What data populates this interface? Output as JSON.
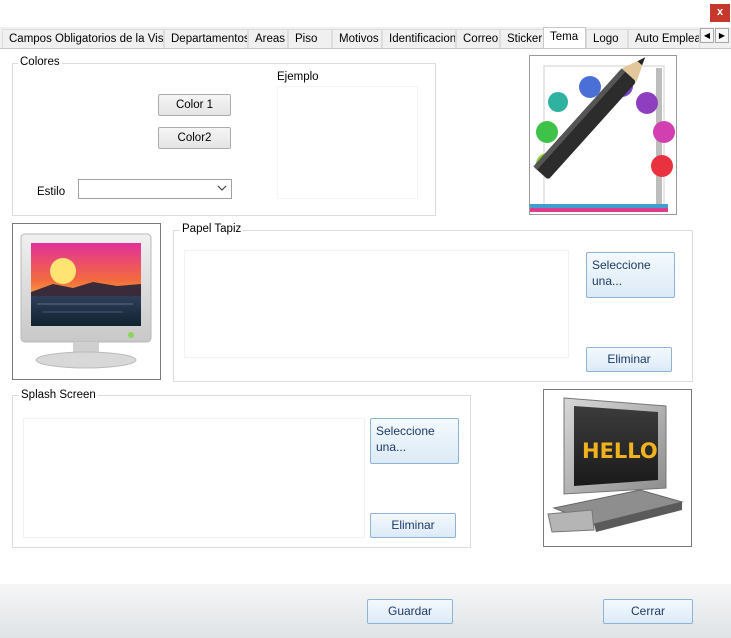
{
  "window": {
    "close_label": "x"
  },
  "tabs": [
    "Campos Obligatorios de la Visita",
    "Departamentos",
    "Areas",
    "Piso",
    "Motivos",
    "Identificacion",
    "Correo",
    "Sticker",
    "Tema",
    "Logo",
    "Auto Empleado"
  ],
  "active_tab": "Tema",
  "colores": {
    "title": "Colores",
    "color1_label": "Color 1",
    "color2_label": "Color2",
    "ejemplo_label": "Ejemplo",
    "estilo_label": "Estilo",
    "estilo_value": ""
  },
  "papel_tapiz": {
    "title": "Papel Tapiz",
    "select_label": "Seleccione una...",
    "delete_label": "Eliminar"
  },
  "splash": {
    "title": "Splash Screen",
    "select_label": "Seleccione una...",
    "delete_label": "Eliminar",
    "preview_text": "HELLO"
  },
  "footer": {
    "save_label": "Guardar",
    "close_label": "Cerrar"
  },
  "icons": [
    "close-icon",
    "scroll-left-icon",
    "scroll-right-icon",
    "chevron-down-icon",
    "palette-pencil-icon",
    "wallpaper-monitor-icon",
    "hello-monitor-icon"
  ]
}
